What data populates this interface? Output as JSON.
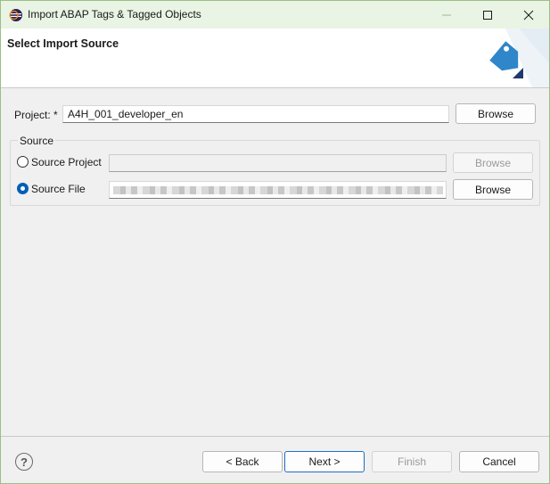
{
  "window": {
    "title": "Import ABAP Tags & Tagged Objects",
    "title_bar_color": "#e9f4e4",
    "controls": {
      "minimize_icon": "minimize-icon",
      "maximize_icon": "maximize-icon",
      "close_icon": "close-icon"
    }
  },
  "banner": {
    "title": "Select Import Source",
    "image_icon": "tag-import-icon"
  },
  "project": {
    "label": "Project: *",
    "value": "A4H_001_developer_en",
    "browse_label": "Browse"
  },
  "source": {
    "group_label": "Source",
    "options": [
      {
        "label": "Source Project",
        "selected": false,
        "value": "",
        "browse_label": "Browse",
        "browse_enabled": false
      },
      {
        "label": "Source File",
        "selected": true,
        "value": "",
        "browse_label": "Browse",
        "browse_enabled": true
      }
    ]
  },
  "footer": {
    "help_icon": "help-icon",
    "help_glyph": "?",
    "buttons": {
      "back": "< Back",
      "next": "Next >",
      "finish": "Finish",
      "cancel": "Cancel"
    }
  },
  "colors": {
    "accent": "#005fb8",
    "tag_icon": "#2f86c9"
  }
}
